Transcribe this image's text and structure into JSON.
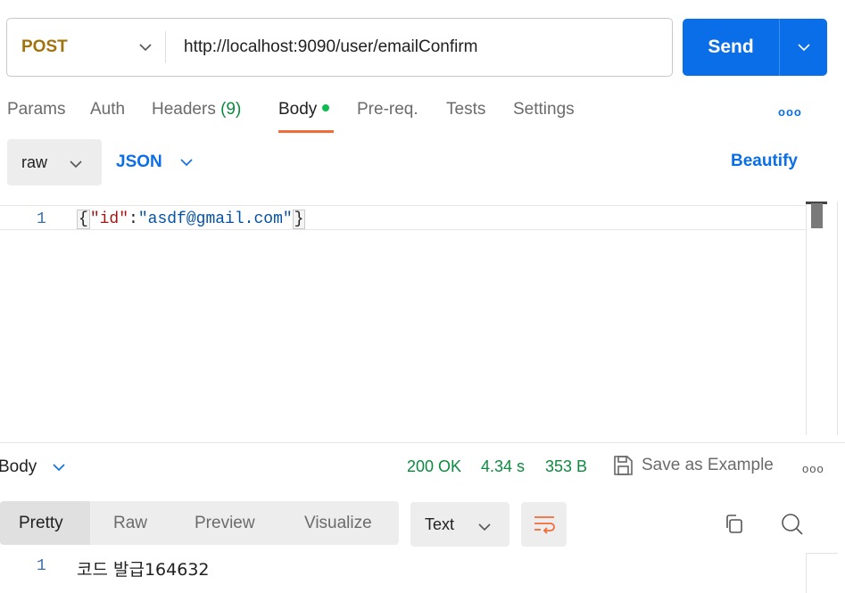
{
  "request": {
    "method": "POST",
    "url": "http://localhost:9090/user/emailConfirm",
    "send_label": "Send"
  },
  "tabs": [
    {
      "label": "Params"
    },
    {
      "label": "Auth"
    },
    {
      "label": "Headers",
      "count": "(9)"
    },
    {
      "label": "Body"
    },
    {
      "label": "Pre-req."
    },
    {
      "label": "Tests"
    },
    {
      "label": "Settings"
    }
  ],
  "more_label": "ooo",
  "body_options": {
    "mode": "raw",
    "language": "JSON",
    "beautify_label": "Beautify"
  },
  "editor": {
    "line_number": "1",
    "open_brace": "{",
    "key": "\"id\"",
    "colon": ":",
    "value": "\"asdf@gmail.com\"",
    "close_brace": "}"
  },
  "response": {
    "body_label": "Body",
    "status": "200 OK",
    "time": "4.34 s",
    "size": "353 B",
    "save_label": "Save as Example",
    "more_label": "ooo",
    "view_tabs": [
      "Pretty",
      "Raw",
      "Preview",
      "Visualize"
    ],
    "format": "Text",
    "line_number": "1",
    "text": "코드 발급164632"
  },
  "colors": {
    "accent": "#0a6ee8",
    "method": "#a2730c",
    "status_ok": "#0c8a3f",
    "tab_underline": "#f26b3a",
    "body_dot": "#0cbb52"
  }
}
